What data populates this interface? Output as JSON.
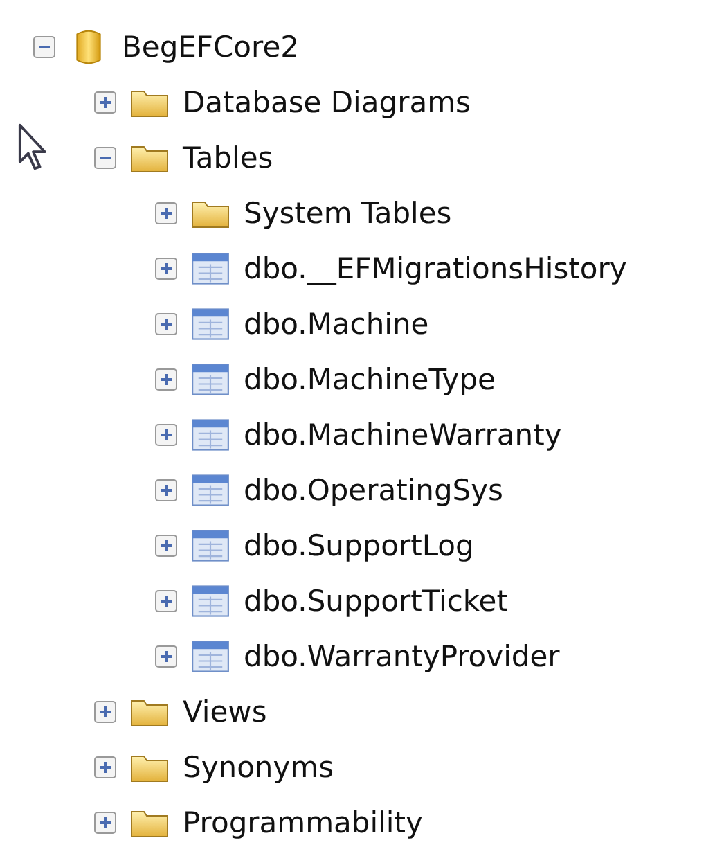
{
  "tree": [
    {
      "label": "BegEFCore2",
      "kind": "database",
      "expanded": true,
      "children": [
        {
          "label": "Database Diagrams",
          "kind": "folder",
          "expanded": false
        },
        {
          "label": "Tables",
          "kind": "folder",
          "expanded": true,
          "children": [
            {
              "label": "System Tables",
              "kind": "folder",
              "expanded": false
            },
            {
              "label": "dbo.__EFMigrationsHistory",
              "kind": "table",
              "expanded": false
            },
            {
              "label": "dbo.Machine",
              "kind": "table",
              "expanded": false
            },
            {
              "label": "dbo.MachineType",
              "kind": "table",
              "expanded": false
            },
            {
              "label": "dbo.MachineWarranty",
              "kind": "table",
              "expanded": false
            },
            {
              "label": "dbo.OperatingSys",
              "kind": "table",
              "expanded": false
            },
            {
              "label": "dbo.SupportLog",
              "kind": "table",
              "expanded": false
            },
            {
              "label": "dbo.SupportTicket",
              "kind": "table",
              "expanded": false
            },
            {
              "label": "dbo.WarrantyProvider",
              "kind": "table",
              "expanded": false
            }
          ]
        },
        {
          "label": "Views",
          "kind": "folder",
          "expanded": false
        },
        {
          "label": "Synonyms",
          "kind": "folder",
          "expanded": false
        },
        {
          "label": "Programmability",
          "kind": "folder",
          "expanded": false
        }
      ]
    }
  ]
}
